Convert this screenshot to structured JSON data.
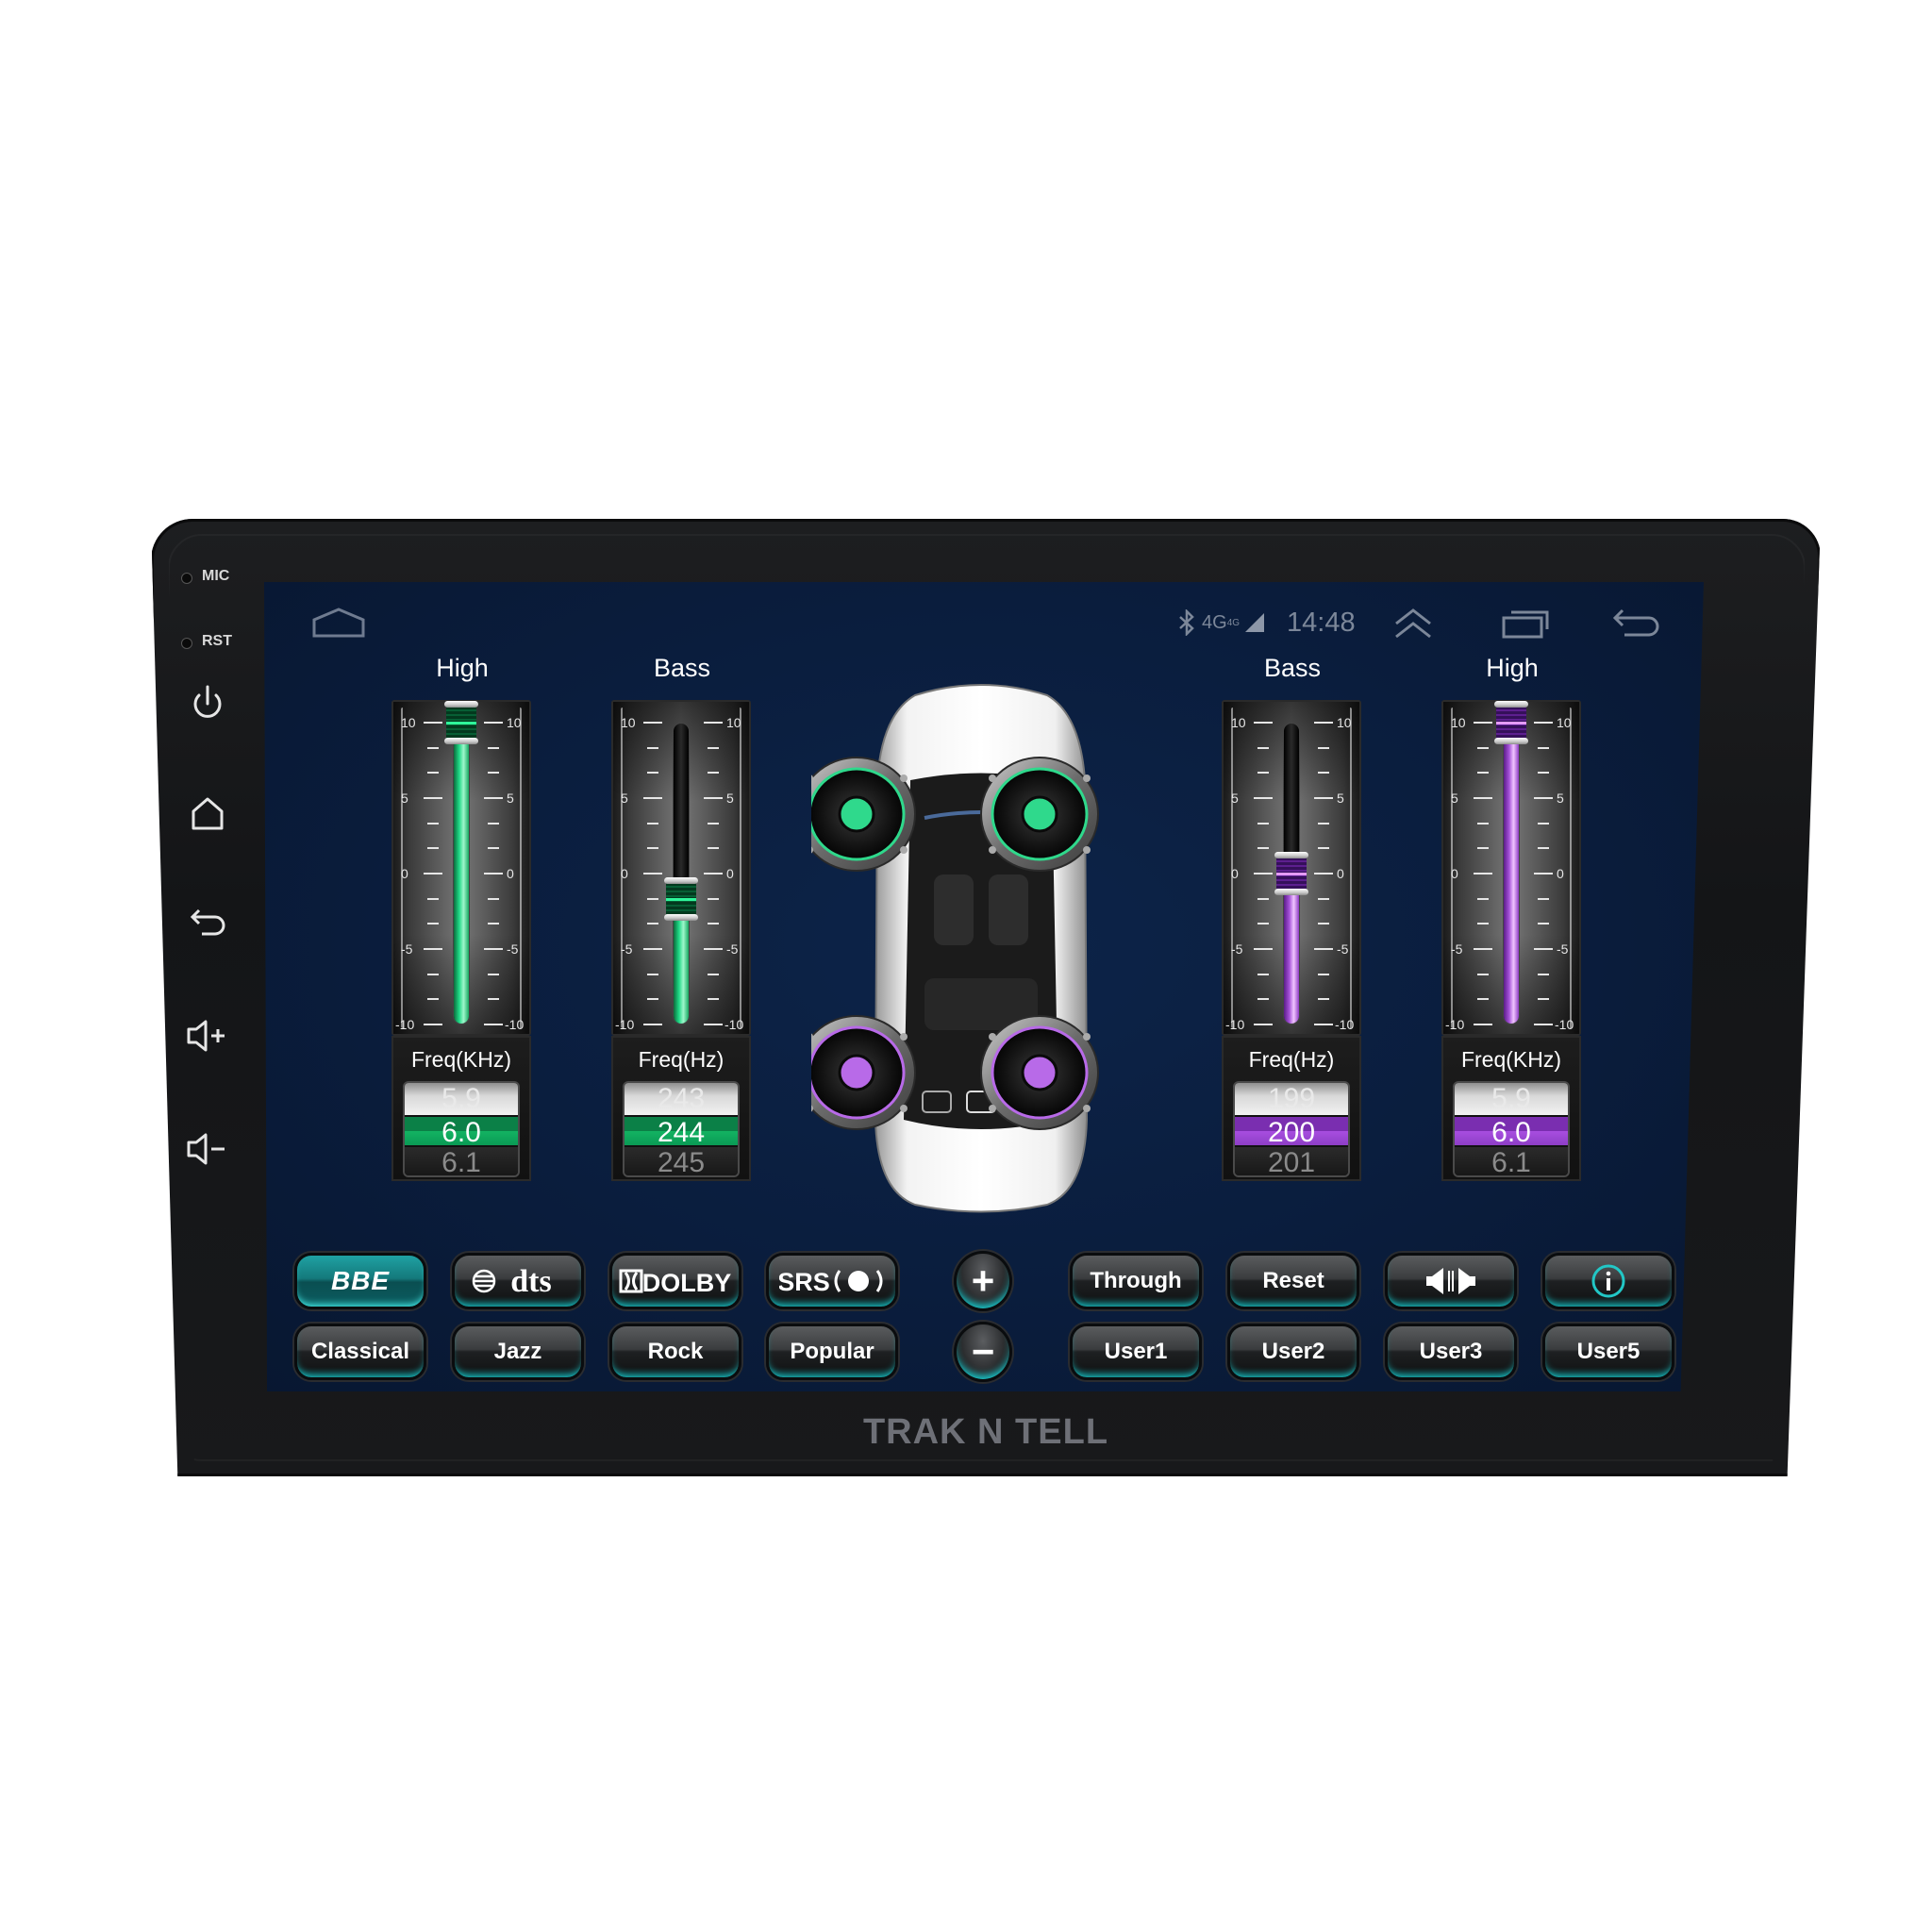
{
  "device": {
    "brand": "TRAK N TELL",
    "bezel_labels": {
      "mic": "MIC",
      "rst": "RST"
    },
    "bezel_buttons": [
      "power-icon",
      "home-icon",
      "back-icon",
      "volume-up-icon",
      "volume-down-icon"
    ]
  },
  "status_bar": {
    "network": "4G",
    "network_sup": "4G",
    "time": "14:48",
    "icons": [
      "home-outline-icon",
      "bluetooth-icon",
      "signal-icon",
      "double-chevron-up-icon",
      "recent-apps-icon",
      "back-icon"
    ]
  },
  "scale": {
    "max": 10,
    "min": -10,
    "labels": [
      "10",
      "5",
      "0",
      "-5",
      "-10"
    ]
  },
  "channels": [
    {
      "id": "front-high",
      "title": "High",
      "freq_label": "Freq(KHz)",
      "gain": 10,
      "color": "green",
      "freq_prev": "5.9",
      "freq_value": "6.0",
      "freq_next": "6.1"
    },
    {
      "id": "front-bass",
      "title": "Bass",
      "freq_label": "Freq(Hz)",
      "gain": -1.7,
      "color": "green",
      "freq_prev": "243",
      "freq_value": "244",
      "freq_next": "245"
    },
    {
      "id": "rear-bass",
      "title": "Bass",
      "freq_label": "Freq(Hz)",
      "gain": 0,
      "color": "purple",
      "freq_prev": "199",
      "freq_value": "200",
      "freq_next": "201"
    },
    {
      "id": "rear-high",
      "title": "High",
      "freq_label": "Freq(KHz)",
      "gain": 10,
      "color": "purple",
      "freq_prev": "5.9",
      "freq_value": "6.0",
      "freq_next": "6.1"
    }
  ],
  "speakers": [
    {
      "position": "front-left",
      "color": "#2fd98c"
    },
    {
      "position": "front-right",
      "color": "#2fd98c"
    },
    {
      "position": "rear-left",
      "color": "#b86ae8"
    },
    {
      "position": "rear-right",
      "color": "#b86ae8"
    }
  ],
  "buttons": {
    "row1": [
      {
        "id": "bbe",
        "label": "BBE",
        "active": true
      },
      {
        "id": "dts",
        "label": "dts",
        "active": false
      },
      {
        "id": "dolby",
        "label": "DOLBY",
        "active": false
      },
      {
        "id": "srs",
        "label": "SRS",
        "active": false
      },
      {
        "id": "plus",
        "label": "+"
      },
      {
        "id": "through",
        "label": "Through",
        "active": false
      },
      {
        "id": "reset",
        "label": "Reset",
        "active": false
      },
      {
        "id": "balance",
        "label": "",
        "icon": "speaker-balance-icon",
        "active": false
      },
      {
        "id": "info",
        "label": "i",
        "icon": "info-icon",
        "active": false
      }
    ],
    "row2": [
      {
        "id": "classical",
        "label": "Classical"
      },
      {
        "id": "jazz",
        "label": "Jazz"
      },
      {
        "id": "rock",
        "label": "Rock"
      },
      {
        "id": "popular",
        "label": "Popular"
      },
      {
        "id": "minus",
        "label": "−"
      },
      {
        "id": "user1",
        "label": "User1"
      },
      {
        "id": "user2",
        "label": "User2"
      },
      {
        "id": "user3",
        "label": "User3"
      },
      {
        "id": "user5",
        "label": "User5"
      }
    ]
  },
  "colors": {
    "accent_green": "#13b362",
    "accent_purple": "#a84ee0",
    "accent_teal": "#19c6c9",
    "screen_bg": "#0a1d3d"
  }
}
